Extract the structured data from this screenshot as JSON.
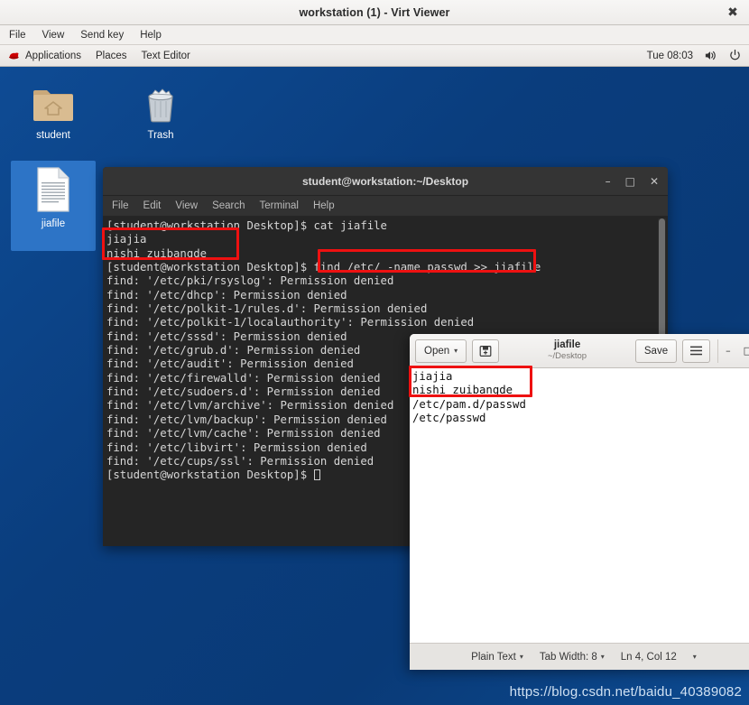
{
  "window": {
    "title": "workstation (1) - Virt Viewer",
    "close_label": "✖",
    "menus": [
      "File",
      "View",
      "Send key",
      "Help"
    ]
  },
  "gnome_panel": {
    "applications_label": "Applications",
    "places_label": "Places",
    "active_app_label": "Text Editor",
    "clock": "Tue 08:03",
    "volume_icon": "volume-icon",
    "power_icon": "power-icon",
    "logo_icon": "redhat-logo-icon"
  },
  "desktop": {
    "background_color": "#0a3d7d",
    "watermark": "https://blog.csdn.net/baidu_40389082",
    "icons": [
      {
        "label": "student",
        "icon": "home-folder-icon",
        "selected": false
      },
      {
        "label": "Trash",
        "icon": "trash-icon",
        "selected": false
      },
      {
        "label": "jiafile",
        "icon": "text-document-icon",
        "selected": true
      }
    ]
  },
  "terminal": {
    "title": "student@workstation:~/Desktop",
    "minimize_label": "–",
    "maximize_label": "□",
    "close_label": "✕",
    "menus": [
      "File",
      "Edit",
      "View",
      "Search",
      "Terminal",
      "Help"
    ],
    "lines": [
      "[student@workstation Desktop]$ cat jiafile",
      "jiajia",
      "nishi zuibangde",
      "[student@workstation Desktop]$ find /etc/ -name passwd >> jiafile",
      "find: '/etc/pki/rsyslog': Permission denied",
      "find: '/etc/dhcp': Permission denied",
      "find: '/etc/polkit-1/rules.d': Permission denied",
      "find: '/etc/polkit-1/localauthority': Permission denied",
      "find: '/etc/sssd': Permission denied",
      "find: '/etc/grub.d': Permission denied",
      "find: '/etc/audit': Permission denied",
      "find: '/etc/firewalld': Permission denied",
      "find: '/etc/sudoers.d': Permission denied",
      "find: '/etc/lvm/archive': Permission denied",
      "find: '/etc/lvm/backup': Permission denied",
      "find: '/etc/lvm/cache': Permission denied",
      "find: '/etc/libvirt': Permission denied",
      "find: '/etc/cups/ssl': Permission denied"
    ],
    "prompt": "[student@workstation Desktop]$ "
  },
  "editor": {
    "open_label": "Open",
    "open_caret": "▾",
    "save_as_icon": "save-as-icon",
    "file_name": "jiafile",
    "file_path": "~/Desktop",
    "save_label": "Save",
    "menu_icon": "hamburger-menu-icon",
    "minimize_label": "–",
    "maximize_label": "□",
    "lines": [
      "jiajia",
      "nishi zuibangde",
      "/etc/pam.d/passwd",
      "/etc/passwd"
    ],
    "status": {
      "language": "Plain Text",
      "tab_width": "Tab Width: 8",
      "cursor_position": "Ln 4, Col 12",
      "caret": "▾"
    }
  },
  "annotations": {
    "color": "#ee1111",
    "boxes": [
      {
        "name": "terminal-cat-output-highlight"
      },
      {
        "name": "terminal-find-command-highlight"
      },
      {
        "name": "editor-original-content-highlight"
      }
    ]
  }
}
